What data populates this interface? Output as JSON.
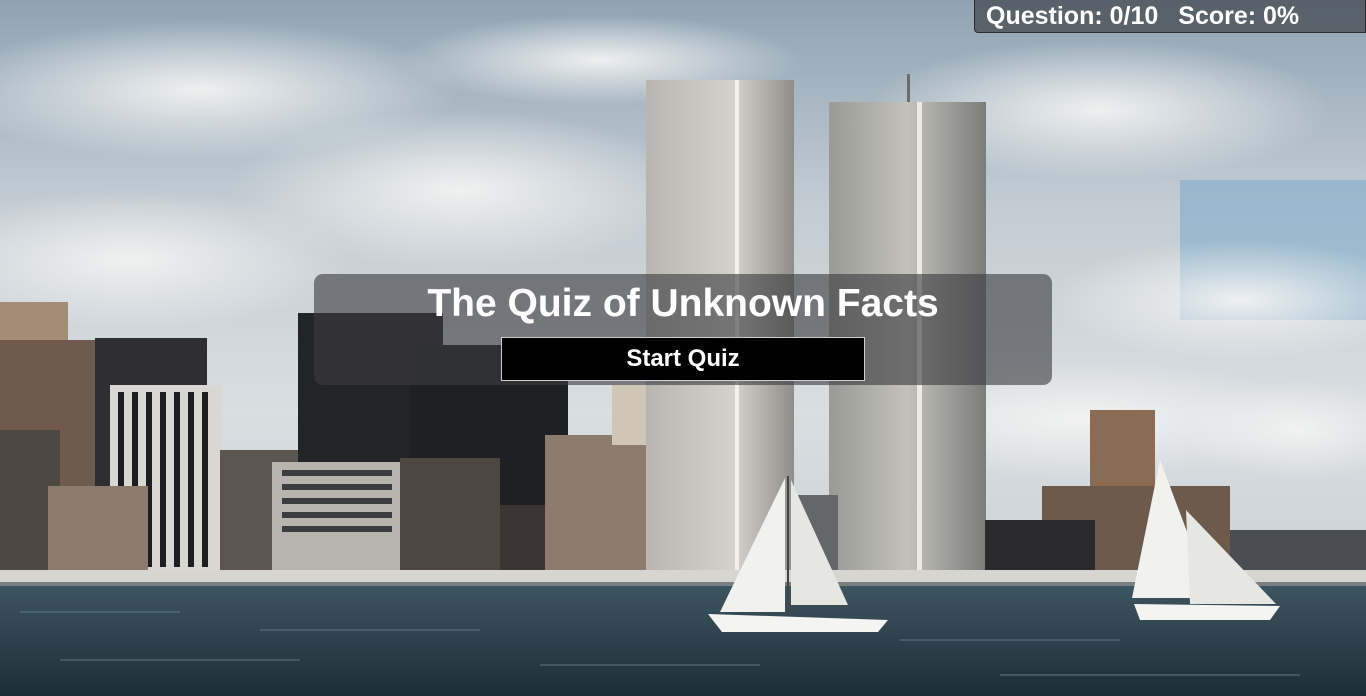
{
  "status": {
    "question_label": "Question: 0/10",
    "score_label": "Score: 0%"
  },
  "quiz": {
    "title": "The Quiz of Unknown Facts",
    "start_label": "Start Quiz"
  },
  "background": {
    "description_icon": "city-skyline-photo"
  },
  "colors": {
    "panel": "#3c3c41",
    "button": "#000000",
    "text": "#ffffff"
  }
}
